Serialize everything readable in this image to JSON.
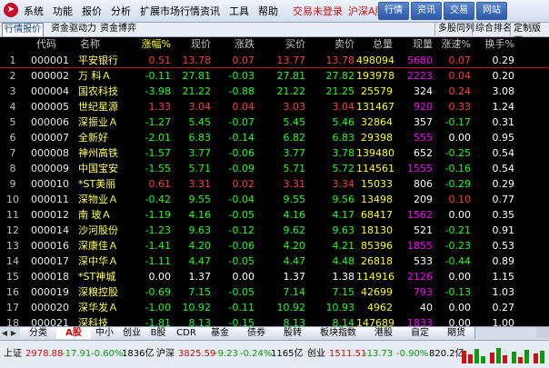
{
  "menu": {
    "items": [
      "系统",
      "功能",
      "报价",
      "分析",
      "扩展市场行情",
      "资讯",
      "工具",
      "帮助"
    ],
    "status": "交易未登录",
    "market": "沪深A股",
    "buttons": [
      "行情",
      "资讯",
      "交易",
      "网站"
    ]
  },
  "tabs": {
    "left": [
      "行情报价",
      "资金驱动力",
      "资金博弈"
    ],
    "right": [
      "多股同列",
      "综合排名",
      "定制版面"
    ]
  },
  "table": {
    "columns": [
      "代码",
      "名称",
      "涨幅%",
      "现价",
      "涨跌",
      "买价",
      "卖价",
      "总量",
      "现量",
      "涨速%",
      "换手%"
    ],
    "rows": [
      {
        "num": "1",
        "code": "000001",
        "name": "平安银行",
        "mark": "",
        "chg_pct": "0.51",
        "price": "13.78",
        "change": "0.07",
        "bid": "13.77",
        "ask": "13.78",
        "volume": "498094",
        "cur_vol": "5680",
        "speed": "0.07",
        "turnover": "0.29",
        "dir": "up",
        "cur_dir": "mag",
        "speed_dir": "up"
      },
      {
        "num": "2",
        "code": "000002",
        "name": "万 科Ａ",
        "mark": "",
        "chg_pct": "-0.11",
        "price": "27.81",
        "change": "-0.03",
        "bid": "27.81",
        "ask": "27.82",
        "volume": "193978",
        "cur_vol": "2223",
        "speed": "0.04",
        "turnover": "0.20",
        "dir": "down",
        "cur_dir": "mag",
        "speed_dir": "up"
      },
      {
        "num": "3",
        "code": "000004",
        "name": "国农科技",
        "mark": "",
        "chg_pct": "-3.98",
        "price": "21.22",
        "change": "-0.88",
        "bid": "21.22",
        "ask": "21.25",
        "volume": "25579",
        "cur_vol": "324",
        "speed": "0.24",
        "turnover": "3.08",
        "dir": "down",
        "cur_dir": "wht",
        "speed_dir": "up"
      },
      {
        "num": "4",
        "code": "000005",
        "name": "世纪星源",
        "mark": "",
        "chg_pct": "1.33",
        "price": "3.04",
        "change": "0.04",
        "bid": "3.03",
        "ask": "3.04",
        "volume": "131467",
        "cur_vol": "920",
        "speed": "0.33",
        "turnover": "1.24",
        "dir": "up",
        "cur_dir": "mag",
        "speed_dir": "up"
      },
      {
        "num": "5",
        "code": "000006",
        "name": "深振业Ａ",
        "mark": "",
        "chg_pct": "-1.27",
        "price": "5.45",
        "change": "-0.07",
        "bid": "5.45",
        "ask": "5.46",
        "volume": "32864",
        "cur_vol": "357",
        "speed": "-0.17",
        "turnover": "0.31",
        "dir": "down",
        "cur_dir": "wht",
        "speed_dir": "down"
      },
      {
        "num": "6",
        "code": "000007",
        "name": "全新好",
        "mark": "",
        "chg_pct": "-2.01",
        "price": "6.83",
        "change": "-0.14",
        "bid": "6.82",
        "ask": "6.83",
        "volume": "29398",
        "cur_vol": "555",
        "speed": "0.00",
        "turnover": "0.95",
        "dir": "down",
        "cur_dir": "mag",
        "speed_dir": "flat"
      },
      {
        "num": "7",
        "code": "000008",
        "name": "神州高铁",
        "mark": "",
        "chg_pct": "-1.57",
        "price": "3.77",
        "change": "-0.06",
        "bid": "3.77",
        "ask": "3.78",
        "volume": "139480",
        "cur_vol": "652",
        "speed": "-0.25",
        "turnover": "0.54",
        "dir": "down",
        "cur_dir": "wht",
        "speed_dir": "down"
      },
      {
        "num": "8",
        "code": "000009",
        "name": "中国宝安",
        "mark": "",
        "chg_pct": "-1.55",
        "price": "5.71",
        "change": "-0.09",
        "bid": "5.71",
        "ask": "5.72",
        "volume": "114561",
        "cur_vol": "1555",
        "speed": "-0.16",
        "turnover": "0.54",
        "dir": "down",
        "cur_dir": "mag",
        "speed_dir": "down"
      },
      {
        "num": "9",
        "code": "000010",
        "name": "*ST美丽",
        "mark": "",
        "chg_pct": "0.61",
        "price": "3.31",
        "change": "0.02",
        "bid": "3.31",
        "ask": "3.34",
        "volume": "15033",
        "cur_vol": "806",
        "speed": "-0.29",
        "turnover": "0.29",
        "dir": "up",
        "cur_dir": "wht",
        "speed_dir": "down"
      },
      {
        "num": "10",
        "code": "000011",
        "name": "深物业Ａ",
        "mark": "",
        "chg_pct": "-0.42",
        "price": "9.55",
        "change": "-0.04",
        "bid": "9.55",
        "ask": "9.56",
        "volume": "13498",
        "cur_vol": "209",
        "speed": "0.10",
        "turnover": "0.77",
        "dir": "down",
        "cur_dir": "wht",
        "speed_dir": "up"
      },
      {
        "num": "11",
        "code": "000012",
        "name": "南 玻Ａ",
        "mark": "",
        "chg_pct": "-1.19",
        "price": "4.16",
        "change": "-0.05",
        "bid": "4.16",
        "ask": "4.17",
        "volume": "68417",
        "cur_vol": "1562",
        "speed": "0.00",
        "turnover": "0.35",
        "dir": "down",
        "cur_dir": "mag",
        "speed_dir": "flat"
      },
      {
        "num": "12",
        "code": "000014",
        "name": "沙河股份",
        "mark": "",
        "chg_pct": "-1.23",
        "price": "9.63",
        "change": "-0.12",
        "bid": "9.62",
        "ask": "9.63",
        "volume": "18130",
        "cur_vol": "521",
        "speed": "-0.21",
        "turnover": "0.91",
        "dir": "down",
        "cur_dir": "wht",
        "speed_dir": "down"
      },
      {
        "num": "13",
        "code": "000016",
        "name": "深康佳Ａ",
        "mark": "",
        "chg_pct": "-1.41",
        "price": "4.20",
        "change": "-0.06",
        "bid": "4.20",
        "ask": "4.21",
        "volume": "85396",
        "cur_vol": "1855",
        "speed": "-0.23",
        "turnover": "0.53",
        "dir": "down",
        "cur_dir": "mag",
        "speed_dir": "down"
      },
      {
        "num": "14",
        "code": "000017",
        "name": "深中华Ａ",
        "mark": "",
        "chg_pct": "-1.11",
        "price": "4.47",
        "change": "-0.05",
        "bid": "4.47",
        "ask": "4.48",
        "volume": "26818",
        "cur_vol": "533",
        "speed": "-0.44",
        "turnover": "0.89",
        "dir": "down",
        "cur_dir": "wht",
        "speed_dir": "down"
      },
      {
        "num": "15",
        "code": "000018",
        "name": "*ST神城",
        "mark": "",
        "chg_pct": "0.00",
        "price": "1.37",
        "change": "0.00",
        "bid": "1.37",
        "ask": "1.38",
        "volume": "114916",
        "cur_vol": "2126",
        "speed": "0.00",
        "turnover": "1.15",
        "dir": "flat",
        "cur_dir": "mag",
        "speed_dir": "flat"
      },
      {
        "num": "16",
        "code": "000019",
        "name": "深粮控股",
        "mark": "",
        "chg_pct": "-0.69",
        "price": "7.15",
        "change": "-0.05",
        "bid": "7.14",
        "ask": "7.15",
        "volume": "42699",
        "cur_vol": "793",
        "speed": "-0.13",
        "turnover": "1.03",
        "dir": "down",
        "cur_dir": "mag",
        "speed_dir": "down"
      },
      {
        "num": "17",
        "code": "000020",
        "name": "深华发Ａ",
        "mark": "",
        "chg_pct": "-1.00",
        "price": "10.92",
        "change": "-0.11",
        "bid": "10.92",
        "ask": "10.93",
        "volume": "4962",
        "cur_vol": "40",
        "speed": "0.00",
        "turnover": "0.27",
        "dir": "down",
        "cur_dir": "wht",
        "speed_dir": "flat"
      },
      {
        "num": "18",
        "code": "000021",
        "name": "深科技",
        "mark": "",
        "chg_pct": "-1.81",
        "price": "8.13",
        "change": "-0.15",
        "bid": "8.13",
        "ask": "8.14",
        "volume": "147689",
        "cur_vol": "1833",
        "speed": "0.00",
        "turnover": "1.00",
        "dir": "down",
        "cur_dir": "mag",
        "speed_dir": "flat"
      }
    ]
  },
  "bottom_tabs": [
    "分类",
    "A股",
    "中小",
    "创业",
    "B股",
    "CDR",
    "基金",
    "债券",
    "股转",
    "板块指数",
    "港股",
    "自定",
    "期货"
  ],
  "bottom_active": "A股",
  "status": {
    "sh_label": "上证",
    "sh_index": "2978.88",
    "sh_change": "-17.91",
    "sh_pct": "-0.60%",
    "sh_amount": "1836亿",
    "hs_label": "沪深",
    "hs_index": "3825.59",
    "hs_change": "-9.23",
    "hs_pct": "-0.24%",
    "hs_amount": "1165亿",
    "cy_label": "创业",
    "cy_index": "1511.51",
    "cy_change": "-13.73",
    "cy_pct": "-0.90%",
    "cy_amount": "820.2亿"
  },
  "colors": {
    "up": "#ff3c3c",
    "down": "#1cff1c",
    "name": "#ffff55",
    "volume": "#ffff00",
    "cur_vol": "#ff00ff",
    "background": "#000000"
  }
}
